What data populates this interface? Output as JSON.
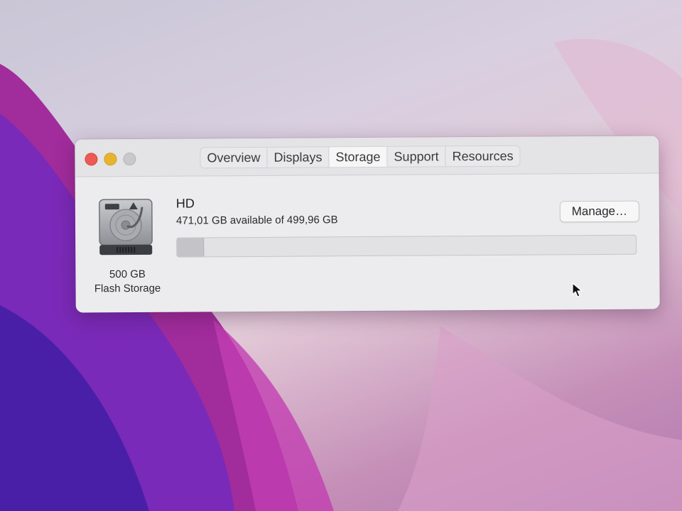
{
  "window": {
    "tabs": [
      {
        "label": "Overview"
      },
      {
        "label": "Displays"
      },
      {
        "label": "Storage"
      },
      {
        "label": "Support"
      },
      {
        "label": "Resources"
      }
    ],
    "active_tab": "Storage"
  },
  "storage": {
    "disk_icon": "hard-drive-icon",
    "capacity_label": "500 GB",
    "type_label": "Flash Storage",
    "drive_name": "HD",
    "availability_text": "471,01 GB available of 499,96 GB",
    "available_gb": 471.01,
    "total_gb": 499.96,
    "used_fraction": 0.058,
    "manage_label": "Manage…"
  },
  "colors": {
    "close": "#ec5a53",
    "minimize": "#e8b430",
    "maximize": "#c9c8cb",
    "wallpaper_purple": "#9a2fa0"
  }
}
